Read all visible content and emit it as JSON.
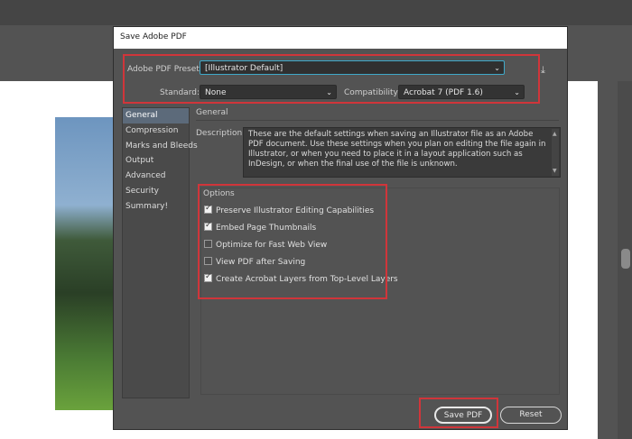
{
  "dialog": {
    "title": "Save Adobe PDF",
    "preset_label": "Adobe PDF Preset:",
    "preset_value": "[Illustrator Default]",
    "standard_label": "Standard:",
    "standard_value": "None",
    "compat_label": "Compatibility:",
    "compat_value": "Acrobat 7 (PDF 1.6)"
  },
  "sidebar": {
    "items": [
      {
        "label": "General"
      },
      {
        "label": "Compression"
      },
      {
        "label": "Marks and Bleeds"
      },
      {
        "label": "Output"
      },
      {
        "label": "Advanced"
      },
      {
        "label": "Security"
      },
      {
        "label": "Summary!"
      }
    ]
  },
  "general": {
    "heading": "General",
    "description_label": "Description:",
    "description_text": "These are the default settings when saving an Illustrator file as an Adobe PDF document. Use these settings when you plan on editing the file again in Illustrator, or when you need to place it in a layout application such as InDesign, or when the final use of the file is unknown."
  },
  "options": {
    "heading": "Options",
    "items": [
      {
        "label": "Preserve Illustrator Editing Capabilities",
        "checked": true
      },
      {
        "label": "Embed Page Thumbnails",
        "checked": true
      },
      {
        "label": "Optimize for Fast Web View",
        "checked": false
      },
      {
        "label": "View PDF after Saving",
        "checked": false
      },
      {
        "label": "Create Acrobat Layers from Top-Level Layers",
        "checked": true
      }
    ]
  },
  "buttons": {
    "save_label": "Save PDF",
    "reset_label": "Reset"
  },
  "icons": {
    "caret": "chevron-down-icon",
    "save_preset": "save-preset-icon"
  },
  "colors": {
    "highlight": "#d0353a",
    "focus": "#3fa9c9"
  }
}
